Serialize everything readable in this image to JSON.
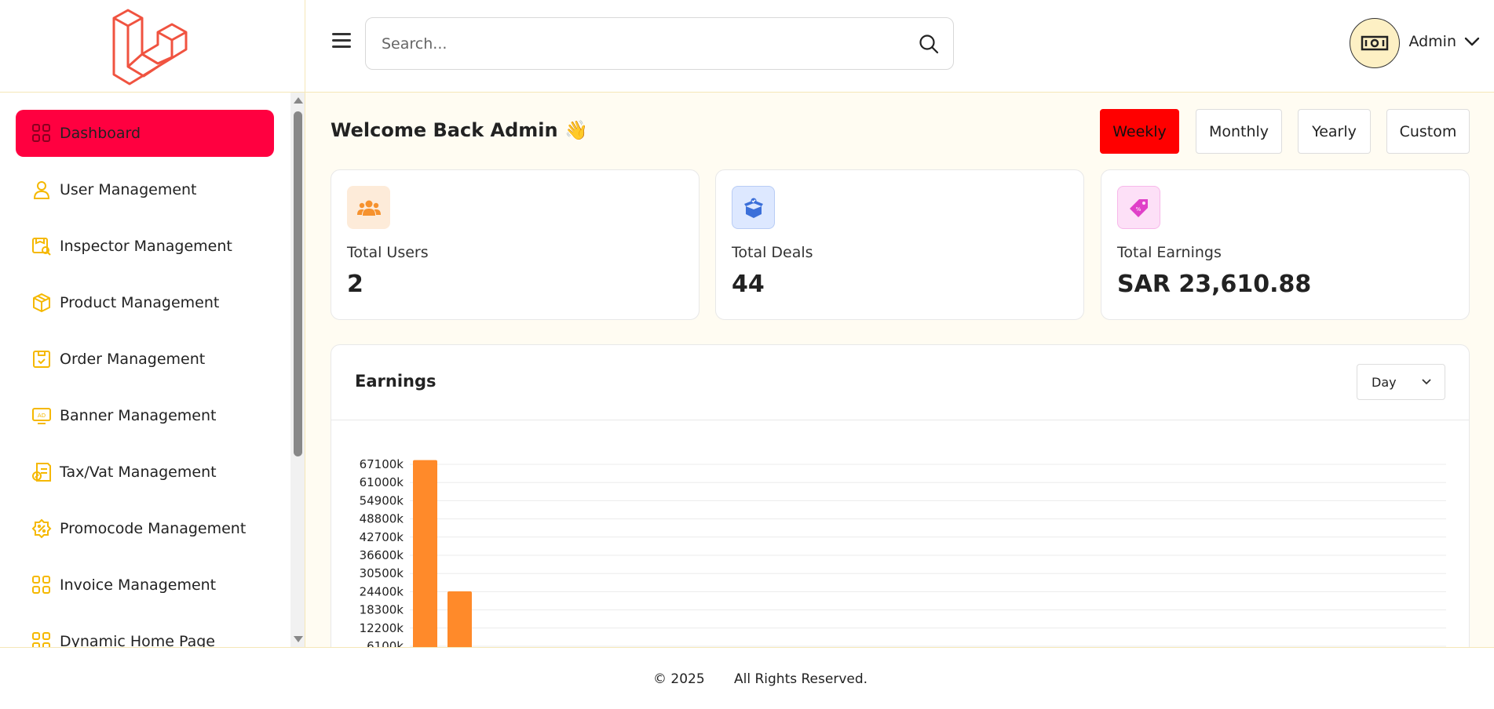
{
  "header": {
    "search_placeholder": "Search...",
    "user_name": "Admin"
  },
  "sidebar": {
    "items": [
      {
        "label": "Dashboard",
        "icon": "grid-icon",
        "active": true
      },
      {
        "label": "User Management",
        "icon": "user-icon"
      },
      {
        "label": "Inspector Management",
        "icon": "inspector-icon"
      },
      {
        "label": "Product Management",
        "icon": "box-icon"
      },
      {
        "label": "Order Management",
        "icon": "order-icon"
      },
      {
        "label": "Banner Management",
        "icon": "banner-icon"
      },
      {
        "label": "Tax/Vat Management",
        "icon": "tax-icon"
      },
      {
        "label": "Promocode Management",
        "icon": "promocode-icon"
      },
      {
        "label": "Invoice Management",
        "icon": "grid-icon"
      },
      {
        "label": "Dynamic Home Page",
        "icon": "grid-icon"
      }
    ]
  },
  "main": {
    "welcome": "Welcome Back Admin 👋",
    "periods": [
      {
        "label": "Weekly",
        "active": true
      },
      {
        "label": "Monthly"
      },
      {
        "label": "Yearly"
      },
      {
        "label": "Custom"
      }
    ],
    "stats": [
      {
        "label": "Total Users",
        "value": "2",
        "icon": "users-icon"
      },
      {
        "label": "Total Deals",
        "value": "44",
        "icon": "deal-box-icon"
      },
      {
        "label": "Total Earnings",
        "value": "SAR 23,610.88",
        "icon": "price-tag-icon"
      }
    ],
    "earnings": {
      "title": "Earnings",
      "range_select": "Day"
    }
  },
  "colors": {
    "accent": "#ff0040",
    "active_period": "#ff0000",
    "icon_yellow": "#f5b800",
    "bar": "#ff8a2a"
  },
  "chart_data": {
    "type": "bar",
    "y_tick_labels": [
      "67100k",
      "61000k",
      "54900k",
      "48800k",
      "42700k",
      "36600k",
      "30500k",
      "24400k",
      "18300k",
      "12200k",
      "6100k"
    ],
    "y_ticks": [
      67100,
      61000,
      54900,
      48800,
      42700,
      36600,
      30500,
      24400,
      18300,
      12200,
      6100
    ],
    "values": [
      68500,
      24500
    ],
    "ylim": [
      0,
      67100
    ]
  },
  "footer": {
    "copyright": "© 2025",
    "rights": "All Rights Reserved."
  }
}
